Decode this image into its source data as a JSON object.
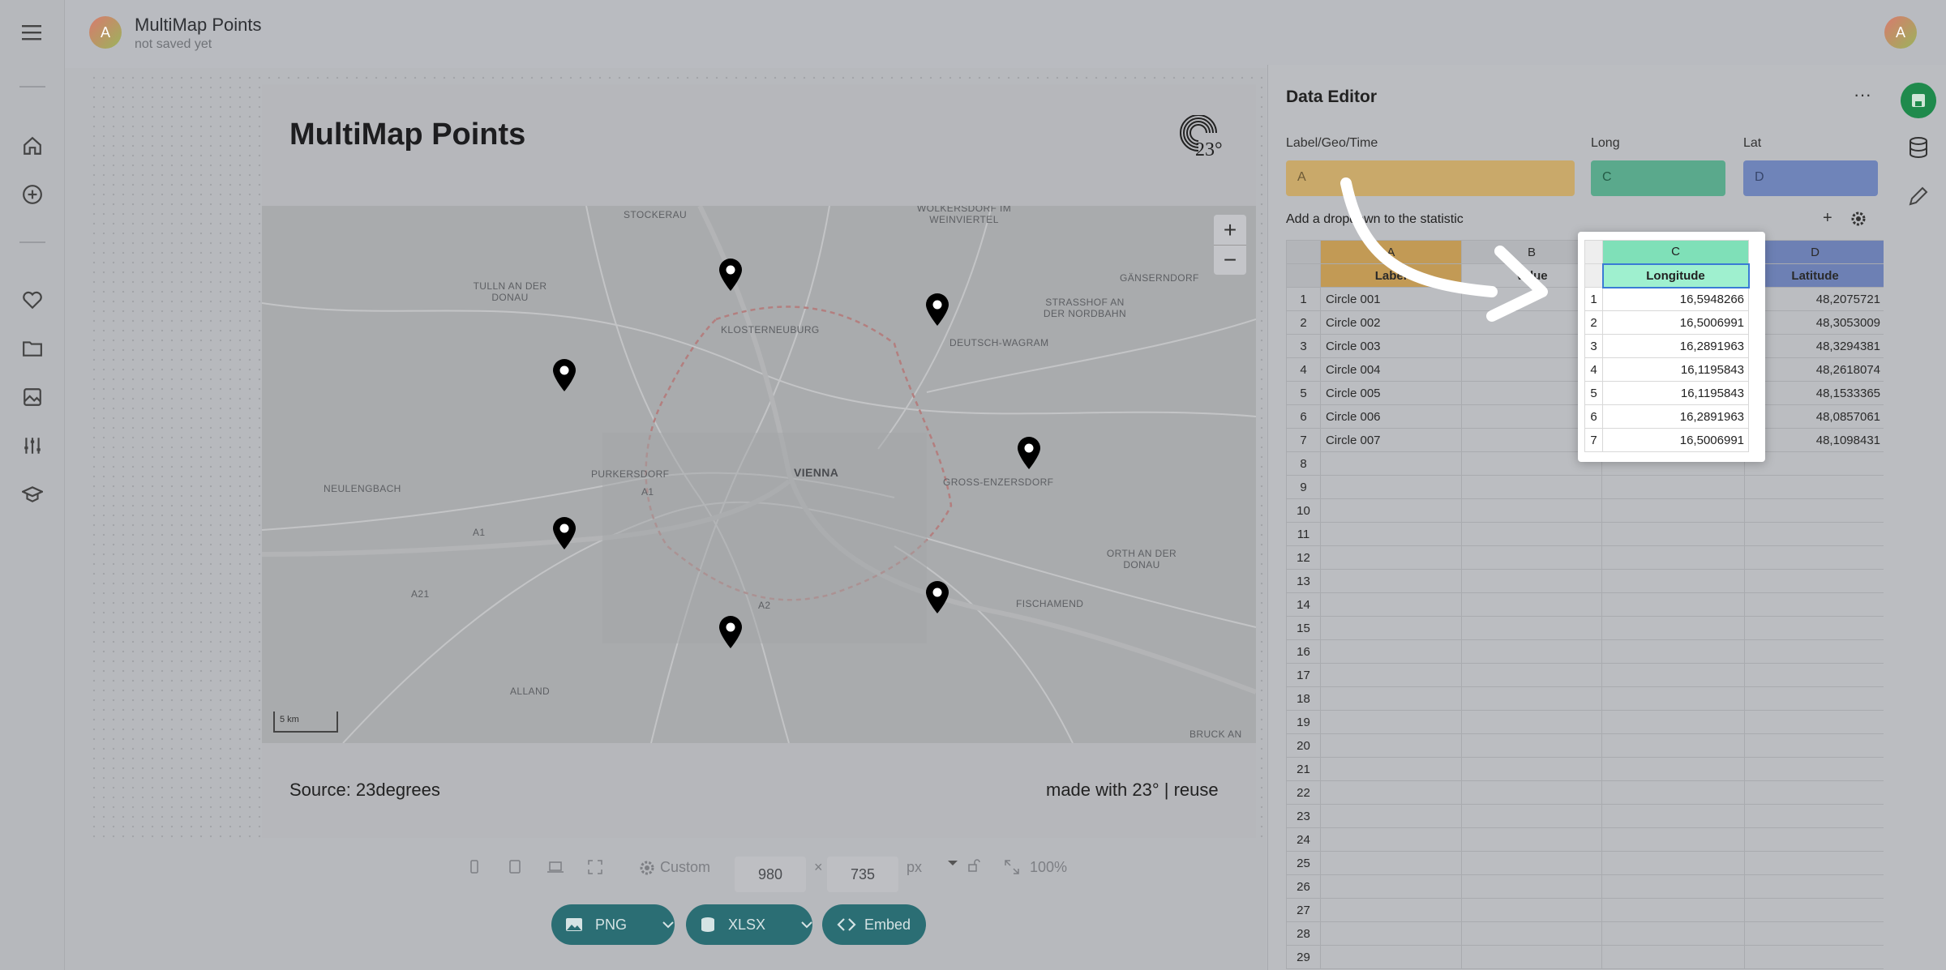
{
  "project": {
    "title": "MultiMap Points",
    "subtitle": "not saved yet",
    "avatar_letter": "A"
  },
  "chart": {
    "title": "MultiMap Points",
    "source": "Source: 23degrees",
    "made_with": "made with 23° | reuse",
    "logo_text": "23°",
    "scale_label": "5 km",
    "map_labels": [
      {
        "text": "STOCKERAU"
      },
      {
        "text": "WOLKERSDORF IM WEINVIERTEL"
      },
      {
        "text": "TULLN AN DER DONAU"
      },
      {
        "text": "GÄNSERNDORF"
      },
      {
        "text": "STRASSHOF AN DER NORDBAHN"
      },
      {
        "text": "KLOSTERNEUBURG"
      },
      {
        "text": "DEUTSCH-WAGRAM"
      },
      {
        "text": "NEULENGBACH"
      },
      {
        "text": "PURKERSDORF"
      },
      {
        "text": "VIENNA"
      },
      {
        "text": "GROSS-ENZERSDORF"
      },
      {
        "text": "ORTH AN DER DONAU"
      },
      {
        "text": "FISCHAMEND"
      },
      {
        "text": "ALLAND"
      },
      {
        "text": "BRUCK AN"
      },
      {
        "text": "A1"
      },
      {
        "text": "A21"
      },
      {
        "text": "A2"
      },
      {
        "text": "A1"
      }
    ]
  },
  "toolbar": {
    "preset": "Custom",
    "width": "980",
    "height": "735",
    "times": "×",
    "unit": "px",
    "zoom": "100%",
    "png": "PNG",
    "xlsx": "XLSX",
    "embed": "Embed"
  },
  "editor": {
    "title": "Data Editor",
    "more": "···",
    "label_geo_time": "Label/Geo/Time",
    "long": "Long",
    "lat": "Lat",
    "field_a": "A",
    "field_c": "C",
    "field_d": "D",
    "dropdown_hint": "Add a dropdown to the statistic",
    "plus": "+",
    "columns": [
      "A",
      "B",
      "C",
      "D"
    ],
    "headers": [
      "Label",
      "Value",
      "Longitude",
      "Latitude"
    ],
    "rows": [
      {
        "n": "1",
        "label": "Circle 001",
        "lon": "16,5948266",
        "lat": "48,2075721"
      },
      {
        "n": "2",
        "label": "Circle 002",
        "lon": "16,5006991",
        "lat": "48,3053009"
      },
      {
        "n": "3",
        "label": "Circle 003",
        "lon": "16,2891963",
        "lat": "48,3294381"
      },
      {
        "n": "4",
        "label": "Circle 004",
        "lon": "16,1195843",
        "lat": "48,2618074"
      },
      {
        "n": "5",
        "label": "Circle 005",
        "lon": "16,1195843",
        "lat": "48,1533365"
      },
      {
        "n": "6",
        "label": "Circle 006",
        "lon": "16,2891963",
        "lat": "48,0857061"
      },
      {
        "n": "7",
        "label": "Circle 007",
        "lon": "16,5006991",
        "lat": "48,1098431"
      }
    ],
    "empty_rows": [
      "8",
      "9",
      "10",
      "11",
      "12",
      "13",
      "14",
      "15",
      "16",
      "17",
      "18",
      "19",
      "20",
      "21",
      "22",
      "23",
      "24",
      "25",
      "26",
      "27",
      "28",
      "29"
    ]
  },
  "colors": {
    "label_field": "#c9a96a",
    "long_field": "#5aa98c",
    "lat_field": "#6f84b9",
    "long_col_header": "#7fe0b8",
    "export_button": "#2b6e74",
    "save_button": "#1f8a4c"
  }
}
